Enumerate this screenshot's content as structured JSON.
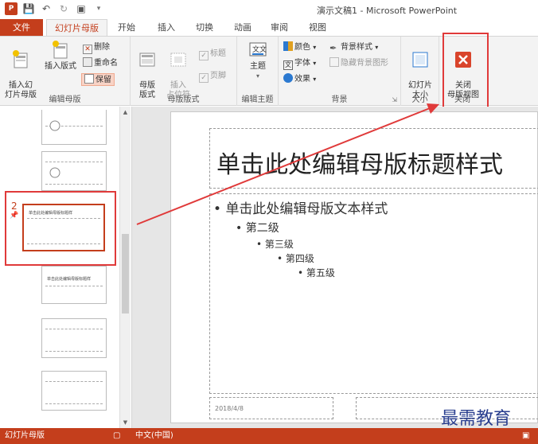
{
  "window": {
    "title": "演示文稿1 - Microsoft PowerPoint"
  },
  "tabs": [
    "文件",
    "幻灯片母版",
    "开始",
    "插入",
    "切换",
    "动画",
    "审阅",
    "视图"
  ],
  "ribbon": {
    "edit_master": {
      "label": "编辑母版",
      "insert_slide_master": "插入幻\n灯片母版",
      "insert_layout": "插入版式",
      "delete": "删除",
      "rename": "重命名",
      "preserve": "保留"
    },
    "master_layout": {
      "label": "母版版式",
      "master_layout_btn": "母版\n版式",
      "insert_placeholder": "插入\n占位符",
      "title_check": "标题",
      "footer_check": "页脚"
    },
    "edit_theme": {
      "label": "编辑主题",
      "themes": "主题"
    },
    "background": {
      "label": "背景",
      "colors": "颜色",
      "fonts": "字体",
      "effects": "效果",
      "bg_styles": "背景样式",
      "hide_bg": "隐藏背景图形"
    },
    "size": {
      "label": "大小",
      "slide_size": "幻灯片\n大小"
    },
    "close": {
      "label": "关闭",
      "close_master": "关闭\n母版视图"
    }
  },
  "thumbnails": {
    "selected_number": "2",
    "thumb_title_a": "单击此处编辑母版标题样",
    "thumb_title_b": "单击此处编辑母版标题样"
  },
  "slide": {
    "title": "单击此处编辑母版标题样式",
    "level1": "单击此处编辑母版文本样式",
    "level2": "第二级",
    "level3": "第三级",
    "level4": "第四级",
    "level5": "第五级",
    "date": "2018/4/8"
  },
  "status": {
    "view": "幻灯片母版",
    "language": "中文(中国)"
  },
  "watermark": "最需教育",
  "colors": {
    "accent": "#c43e1c",
    "annotation": "#e03a3a"
  }
}
